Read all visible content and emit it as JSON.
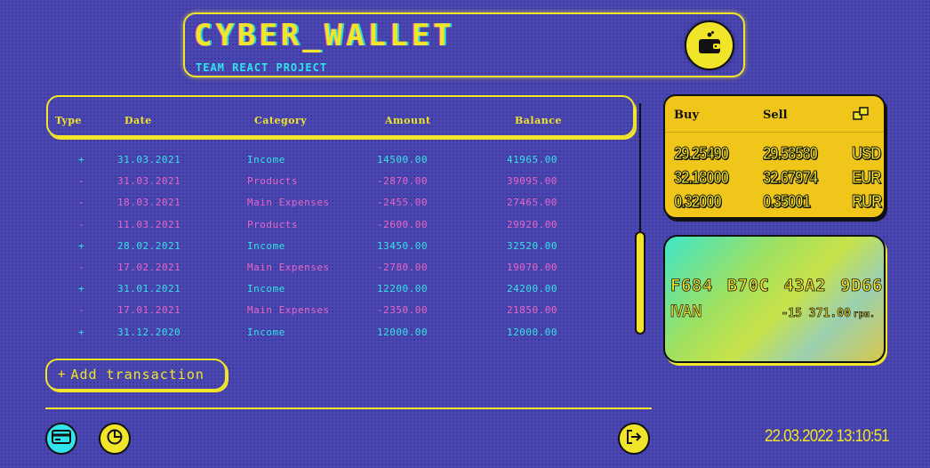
{
  "header": {
    "title": "CYBER_WALLET",
    "subtitle": "TEAM REACT PROJECT",
    "wallet_icon": "wallet-icon"
  },
  "table": {
    "columns": [
      "Type",
      "Date",
      "Category",
      "Amount",
      "Balance"
    ],
    "rows": [
      {
        "type": "+",
        "date": "31.03.2021",
        "category": "Income",
        "amount": "14500.00",
        "balance": "41965.00",
        "kind": "income"
      },
      {
        "type": "-",
        "date": "31.03.2021",
        "category": "Products",
        "amount": "-2870.00",
        "balance": "39095.00",
        "kind": "expense"
      },
      {
        "type": "-",
        "date": "18.03.2021",
        "category": "Main Expenses",
        "amount": "-2455.00",
        "balance": "27465.00",
        "kind": "expense"
      },
      {
        "type": "-",
        "date": "11.03.2021",
        "category": "Products",
        "amount": "-2600.00",
        "balance": "29920.00",
        "kind": "expense"
      },
      {
        "type": "+",
        "date": "28.02.2021",
        "category": "Income",
        "amount": "13450.00",
        "balance": "32520.00",
        "kind": "income"
      },
      {
        "type": "-",
        "date": "17.02.2021",
        "category": "Main Expenses",
        "amount": "-2780.00",
        "balance": "19070.00",
        "kind": "expense"
      },
      {
        "type": "+",
        "date": "31.01.2021",
        "category": "Income",
        "amount": "12200.00",
        "balance": "24200.00",
        "kind": "income"
      },
      {
        "type": "-",
        "date": "17.01.2021",
        "category": "Main Expenses",
        "amount": "-2350.00",
        "balance": "21850.00",
        "kind": "expense"
      },
      {
        "type": "+",
        "date": "31.12.2020",
        "category": "Income",
        "amount": "12000.00",
        "balance": "12000.00",
        "kind": "income"
      }
    ]
  },
  "actions": {
    "add_plus": "+",
    "add_label": "Add transaction"
  },
  "nav": {
    "cards_icon": "credit-card-icon",
    "stats_icon": "pie-chart-icon",
    "exit_icon": "logout-icon"
  },
  "datetime": "22.03.2022 13:10:51",
  "currency": {
    "buy_label": "Buy",
    "sell_label": "Sell",
    "refresh_icon": "refresh-icon",
    "rates": [
      {
        "buy": "29.25490",
        "sell": "29.58580",
        "code": "USD"
      },
      {
        "buy": "32.18000",
        "sell": "32.67974",
        "code": "EUR"
      },
      {
        "buy": "0.32000",
        "sell": "0.35001",
        "code": "RUR"
      }
    ]
  },
  "card": {
    "number": "F684 B70C 43A2 9D66",
    "holder": "IVAN",
    "balance": "-15 371.00",
    "unit": "грн."
  },
  "colors": {
    "background": "#4a46b4",
    "accent_yellow": "#f1e52a",
    "income": "#36e3e6",
    "expense": "#e866c6"
  }
}
